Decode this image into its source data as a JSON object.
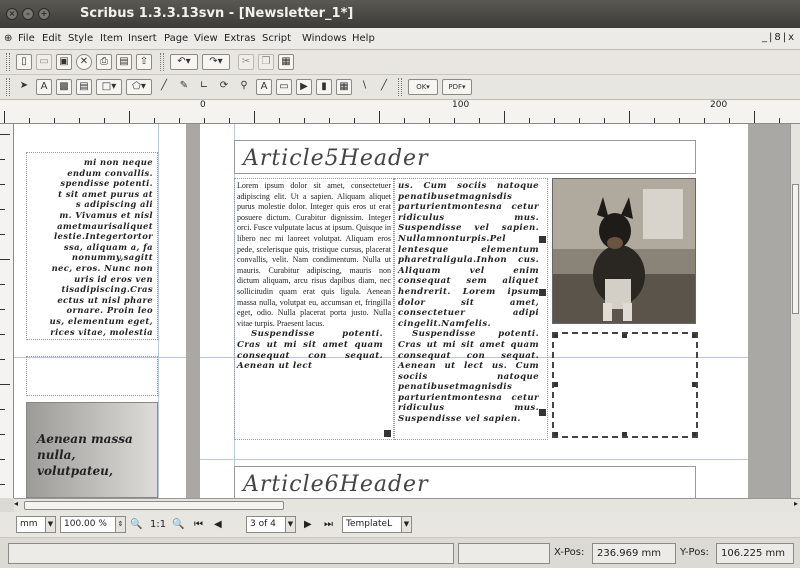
{
  "window": {
    "title": "Scribus 1.3.3.13svn - [Newsletter_1*]"
  },
  "menu": [
    {
      "label": "File"
    },
    {
      "label": "Edit"
    },
    {
      "label": "Style"
    },
    {
      "label": "Item"
    },
    {
      "label": "Insert"
    },
    {
      "label": "Page"
    },
    {
      "label": "View"
    },
    {
      "label": "Extras"
    },
    {
      "label": "Script"
    },
    {
      "label": "Windows"
    },
    {
      "label": "Help"
    }
  ],
  "mdi_controls": "_|8|x",
  "ruler": {
    "labels": [
      "0",
      "100",
      "200"
    ]
  },
  "left_page": {
    "text_lines": [
      "mi non neque",
      "endum convallis.",
      "spendisse potenti.",
      "t sit amet purus at",
      "s adipiscing ali",
      "m. Vivamus et nisl",
      "ametmaurisaliquet",
      "lestie.Integertortor",
      "ssa, aliquam a, fa",
      "nonummy,sagitt",
      "nec, eros. Nunc non",
      "uris id eros ven",
      "tisadipiscing.Cras",
      "ectus ut nisl phare",
      "ornare. Proin leo",
      "us, elementum eget,",
      "rices vitae, molestia"
    ],
    "box_text": "Aenean massa nulla, volutpateu,"
  },
  "article5": {
    "header": "Article5Header",
    "col1": "Lorem ipsum dolor sit amet, consectetuer adipiscing elit. Ut a sapien. Aliquam aliquet purus molestie dolor. Integer quis eros ut erat posuere dictum. Curabitur dignissim. Integer orci. Fusce vulputate lacus at ipsum. Quisque in libero nec mi laoreet volutpat. Aliquam eros pede, scelerisque quis, tristique cursus, placerat convallis, velit. Nam condimentum. Nulla ut mauris. Curabitur adipiscing, mauris non dictum aliquam, arcu risus dapibus diam, nec sollicitudin quam erat quis ligula. Aenean massa nulla, volutpat eu, accumsan et, fringilla eget, odio. Nulla placerat porta justo. Nulla vitae turpis. Praesent lacus.",
    "col1_tail": "Suspendisse potenti. Cras ut mi sit amet quam consequat con sequat. Aenean ut lect",
    "col2": "us. Cum sociis natoque penatibusetmagnisdis parturientmontesna cetur ridiculus mus. Suspendisse vel sapien. Nullamnonturpis.Pel lentesque elementum pharetraligula.Inhon cus. Aliquam vel enim consequat sem aliquet hendrerit. Lorem ipsum dolor sit amet, consectetuer adipi cingelit.Namfelis.",
    "col2_tail": "Suspendisse potenti. Cras ut mi sit amet quam consequat con sequat. Aenean ut lect us. Cum sociis natoque penatibusetmagnisdis parturientmontesna cetur ridiculus mus. Suspendisse vel sapien."
  },
  "article6": {
    "header": "Article6Header"
  },
  "nav": {
    "unit": "mm",
    "zoom": "100.00 %",
    "zoom_reset": "1:1",
    "page": "3 of 4",
    "layer": "TemplateL"
  },
  "status": {
    "xpos_label": "X-Pos:",
    "xpos_value": "236.969 mm",
    "ypos_label": "Y-Pos:",
    "ypos_value": "106.225 mm"
  },
  "colors": {
    "accent": "#3c3b37",
    "guide": "#b8c8e0"
  }
}
